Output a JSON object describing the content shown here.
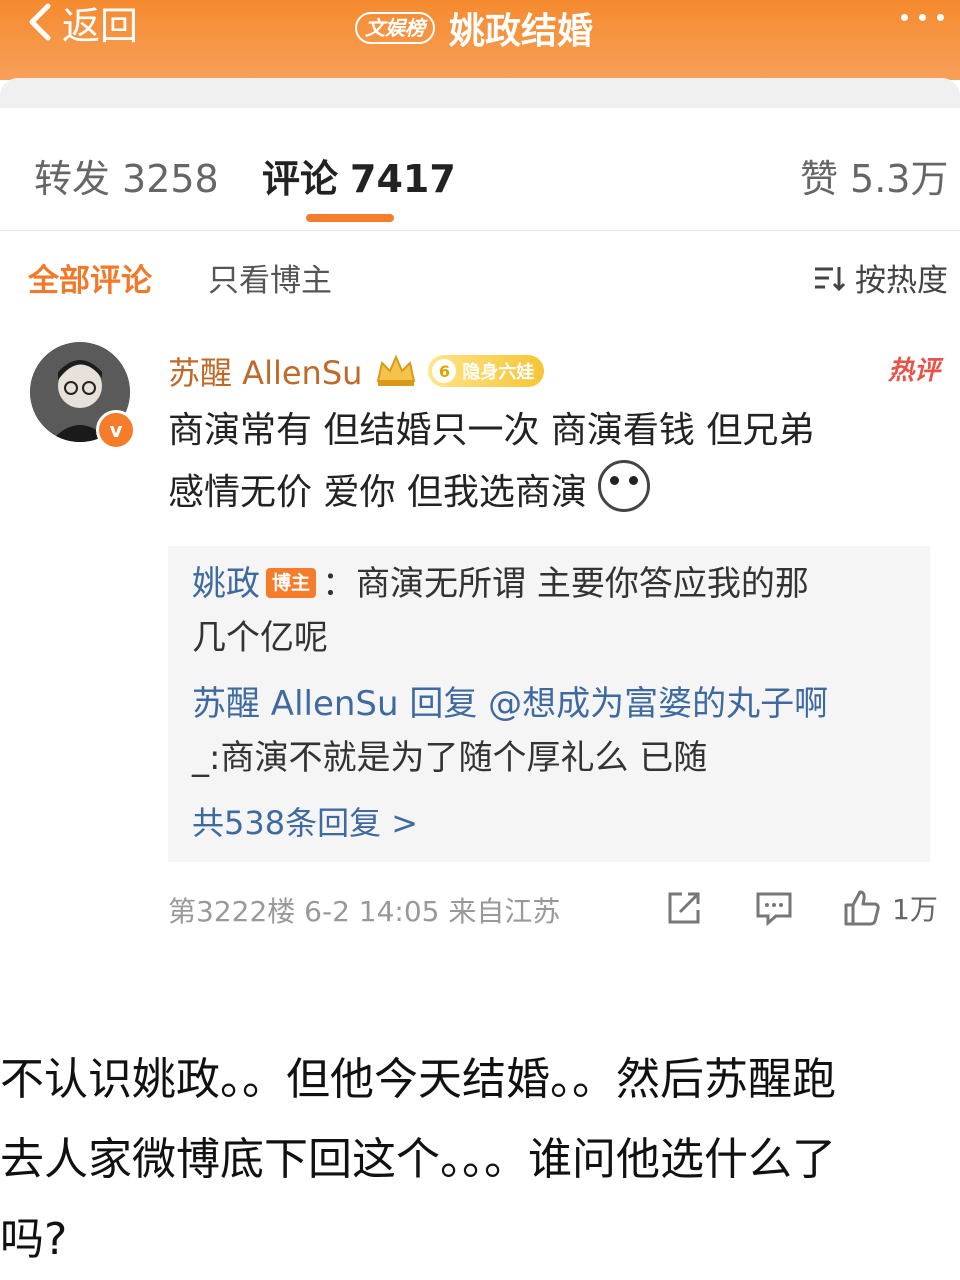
{
  "header": {
    "back_label": "返回",
    "badge": "文娱榜",
    "title": "姚政结婚"
  },
  "tabs": [
    {
      "label": "转发",
      "count": "3258"
    },
    {
      "label": "评论",
      "count": "7417"
    },
    {
      "label": "赞",
      "count": "5.3万"
    }
  ],
  "filter": {
    "all": "全部评论",
    "owner_only": "只看博主",
    "sort": "按热度"
  },
  "comment": {
    "user": "苏醒 AllenSu",
    "fan_level": "6",
    "fan_label": "隐身六娃",
    "verified_mark": "v",
    "hot_tag": "热评",
    "text_line1": "商演常有 但结婚只一次 商演看钱 但兄弟",
    "text_line2": "感情无价 爱你 但我选商演",
    "replies": {
      "r1_name": "姚政",
      "r1_owner_tag": "博主",
      "r1_text_line1": "：商演无所谓 主要你答应我的那",
      "r1_text_line2": "几个亿呢",
      "r2_line1_name": "苏醒 AllenSu",
      "r2_line1_rest": " 回复 @想成为富婆的丸子啊",
      "r2_line2": "_:商演不就是为了随个厚礼么 已随",
      "total": "共538条回复 >"
    },
    "meta": "第3222楼  6-2 14:05  来自江苏",
    "likes": "1万"
  },
  "caption": {
    "line1": "不认识姚政。。但他今天结婚。。然后苏醒跑",
    "line2": "去人家微博底下回这个。。。谁问他选什么了",
    "line3": "吗?"
  },
  "colors": {
    "header": "#f58a2e",
    "accent": "#f07a2a",
    "link": "#3e6aa0",
    "hot": "#e8534a"
  }
}
